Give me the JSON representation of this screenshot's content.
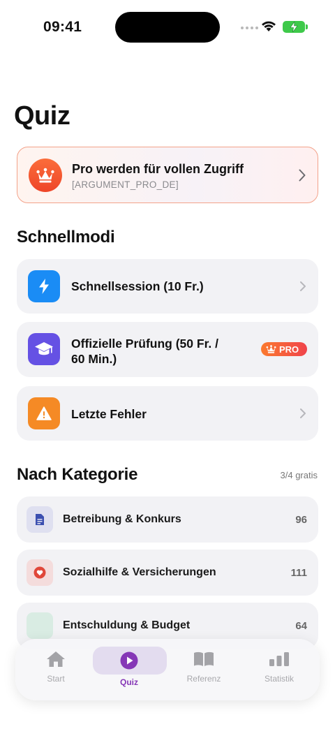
{
  "status": {
    "time": "09:41"
  },
  "page": {
    "title": "Quiz"
  },
  "pro_banner": {
    "title": "Pro werden für vollen Zugriff",
    "subtitle": "[ARGUMENT_PRO_DE]",
    "icon": "crown-icon"
  },
  "quick_modes": {
    "title": "Schnellmodi",
    "items": [
      {
        "label": "Schnellsession (10 Fr.)",
        "icon": "bolt-icon",
        "color": "#1a8cf5"
      },
      {
        "label_line1": "Offizielle Prüfung (50 Fr. /",
        "label_line2": "60 Min.)",
        "icon": "graduation-cap-icon",
        "color": "#6551e4",
        "badge": "PRO"
      },
      {
        "label": "Letzte Fehler",
        "icon": "warning-icon",
        "color": "#f58a25"
      }
    ]
  },
  "categories": {
    "title": "Nach Kategorie",
    "meta": "3/4 gratis",
    "items": [
      {
        "label": "Betreibung & Konkurs",
        "count": "96",
        "icon": "document-icon",
        "color": "#3b4fb0"
      },
      {
        "label": "Sozialhilfe & Versicherungen",
        "count": "111",
        "icon": "heart-icon",
        "color": "#e0473a"
      },
      {
        "label": "Entschuldung & Budget",
        "count": "64",
        "icon": "budget-icon",
        "color": "#47a47a"
      }
    ]
  },
  "tab_bar": {
    "tabs": [
      {
        "label": "Start",
        "icon": "home-icon"
      },
      {
        "label": "Quiz",
        "icon": "play-icon",
        "active": true
      },
      {
        "label": "Referenz",
        "icon": "book-icon"
      },
      {
        "label": "Statistik",
        "icon": "chart-icon"
      }
    ]
  },
  "colors": {
    "accent": "#8537b6",
    "pro_orange": "#f25a2d"
  }
}
